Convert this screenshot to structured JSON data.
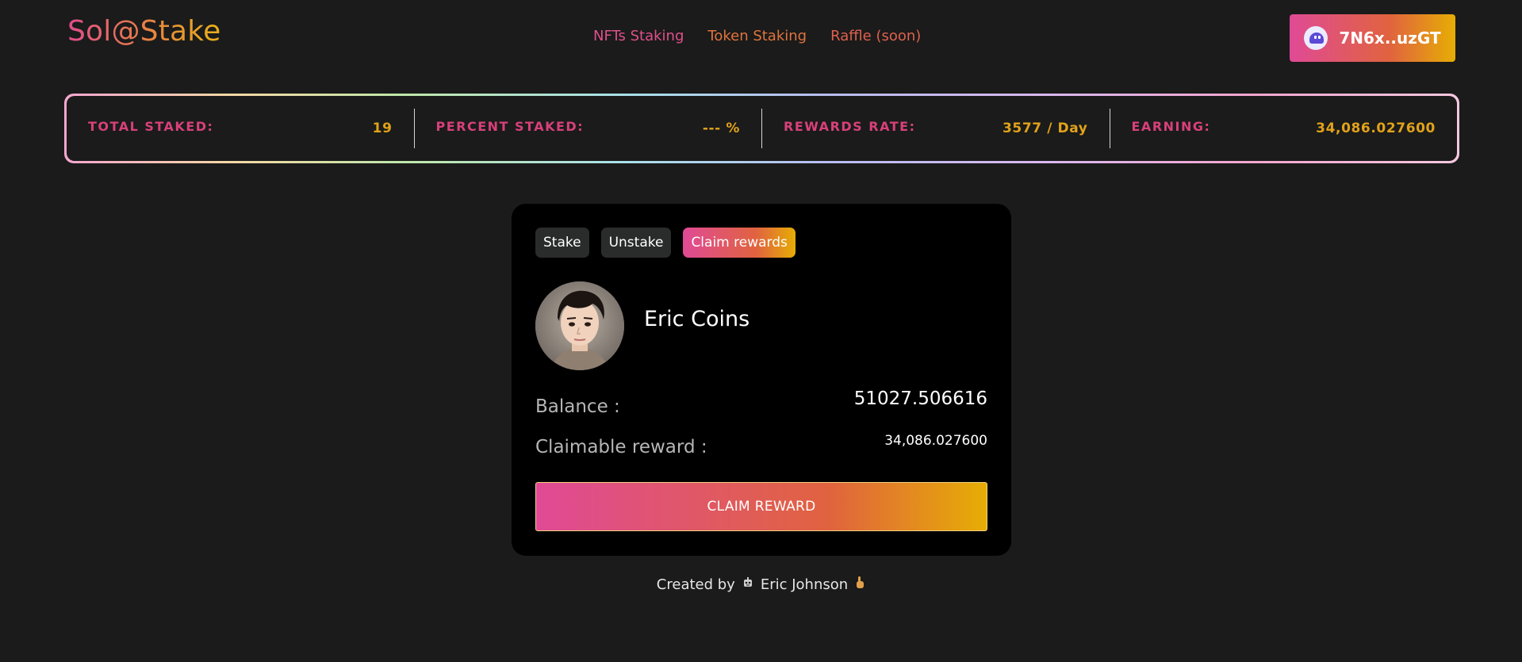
{
  "header": {
    "logo": "Sol@Stake",
    "nav": [
      {
        "label": "NFTs Staking"
      },
      {
        "label": "Token Staking"
      },
      {
        "label": "Raffle (soon)"
      }
    ],
    "wallet_label": "7N6x..uzGT",
    "wallet_icon": "phantom-ghost-icon"
  },
  "stats": [
    {
      "label": "TOTAL STAKED:",
      "value": "19"
    },
    {
      "label": "PERCENT STAKED:",
      "value": "--- %"
    },
    {
      "label": "REWARDS RATE:",
      "value": "3577 / Day"
    },
    {
      "label": "EARNING:",
      "value": "34,086.027600"
    }
  ],
  "card": {
    "tabs": [
      {
        "label": "Stake",
        "active": false
      },
      {
        "label": "Unstake",
        "active": false
      },
      {
        "label": "Claim rewards",
        "active": true
      }
    ],
    "user_name": "Eric Coins",
    "balance_label": "Balance :",
    "balance_value": "51027.506616",
    "claimable_label": "Claimable reward :",
    "claimable_value": "34,086.027600",
    "claim_button": "CLAIM REWARD"
  },
  "footer": {
    "prefix": "Created by",
    "author": "Eric Johnson",
    "icons": [
      "robot-icon",
      "hand-icon"
    ]
  },
  "colors": {
    "background": "#1a1b1a",
    "accent_pink": "#e04a96",
    "accent_orange": "#e0633f",
    "accent_gold": "#e6ad04"
  }
}
